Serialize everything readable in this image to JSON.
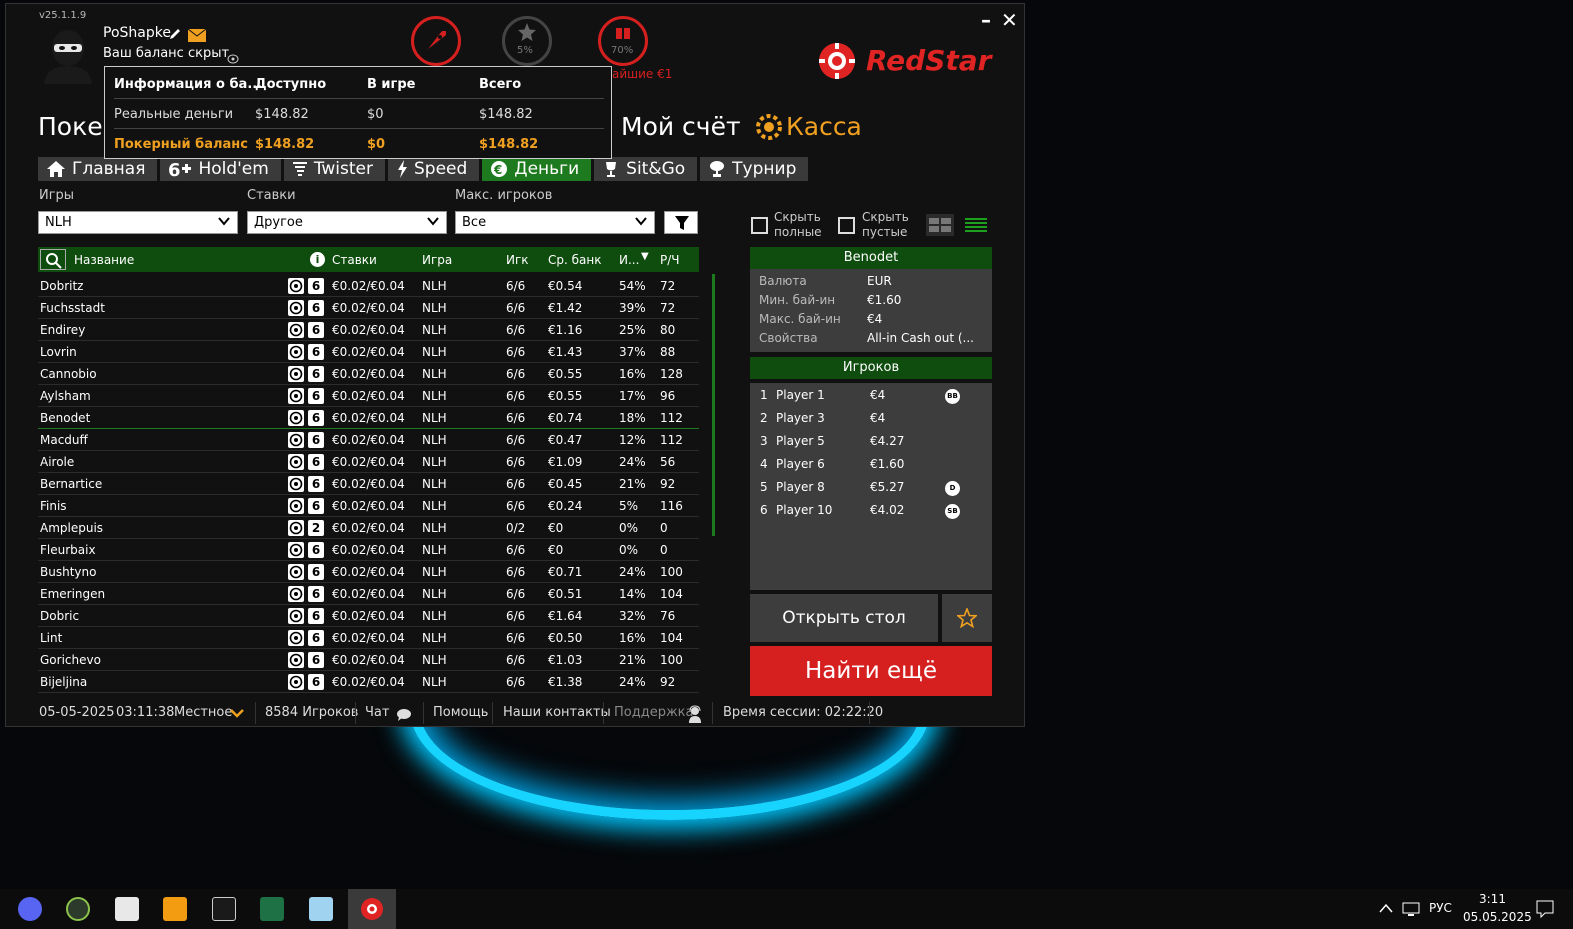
{
  "app": {
    "version": "v25.1.1.9",
    "brand": "RedStar",
    "brand_color": "#e02424",
    "accent_green": "#1e7a1e"
  },
  "user": {
    "name": "PoShapke",
    "balance_hidden": "Ваш баланс скрыт",
    "star_progress": "5%",
    "gift_progress": "70%",
    "gift_note": "айшие €1"
  },
  "balance_popup": {
    "headers": [
      "Информация о ба...",
      "Доступно",
      "В игре",
      "Всего"
    ],
    "rows": [
      [
        "Реальные деньги",
        "$148.82",
        "$0",
        "$148.82"
      ],
      [
        "Покерный баланс",
        "$148.82",
        "$0",
        "$148.82"
      ]
    ]
  },
  "header": {
    "poker_title": "Покер",
    "account": "Мой счёт",
    "cashier": "Касса"
  },
  "tabs": [
    {
      "label": "Главная",
      "icon": "home-icon"
    },
    {
      "label": "Hold'em",
      "icon": "sixplus-icon"
    },
    {
      "label": "Twister",
      "icon": "tornado-icon"
    },
    {
      "label": "Speed",
      "icon": "lightning-icon"
    },
    {
      "label": "Деньги",
      "icon": "euro-icon",
      "active": true
    },
    {
      "label": "Sit&Go",
      "icon": "trophy-icon"
    },
    {
      "label": "Турнир",
      "icon": "cup-icon"
    }
  ],
  "filters": {
    "games_label": "Игры",
    "games_value": "NLH",
    "stakes_label": "Ставки",
    "stakes_value": "Другое",
    "players_label": "Макс. игроков",
    "players_value": "Все",
    "hide_full_1": "Скрыть",
    "hide_full_2": "полные",
    "hide_empty_1": "Скрыть",
    "hide_empty_2": "пустые"
  },
  "table": {
    "headers": {
      "name": "Название",
      "stakes": "Ставки",
      "game": "Игра",
      "players": "Игк",
      "avg_pot": "Ср. банк",
      "flop": "И...",
      "hands": "Р/Ч"
    },
    "rows": [
      {
        "name": "Dobritz",
        "seats": "6",
        "stakes": "€0.02/€0.04",
        "game": "NLH",
        "players": "6/6",
        "avg_pot": "€0.54",
        "flop": "54%",
        "hands": "72"
      },
      {
        "name": "Fuchsstadt",
        "seats": "6",
        "stakes": "€0.02/€0.04",
        "game": "NLH",
        "players": "6/6",
        "avg_pot": "€1.42",
        "flop": "39%",
        "hands": "72"
      },
      {
        "name": "Endirey",
        "seats": "6",
        "stakes": "€0.02/€0.04",
        "game": "NLH",
        "players": "6/6",
        "avg_pot": "€1.16",
        "flop": "25%",
        "hands": "80"
      },
      {
        "name": "Lovrin",
        "seats": "6",
        "stakes": "€0.02/€0.04",
        "game": "NLH",
        "players": "6/6",
        "avg_pot": "€1.43",
        "flop": "37%",
        "hands": "88"
      },
      {
        "name": "Cannobio",
        "seats": "6",
        "stakes": "€0.02/€0.04",
        "game": "NLH",
        "players": "6/6",
        "avg_pot": "€0.55",
        "flop": "16%",
        "hands": "128"
      },
      {
        "name": "Aylsham",
        "seats": "6",
        "stakes": "€0.02/€0.04",
        "game": "NLH",
        "players": "6/6",
        "avg_pot": "€0.55",
        "flop": "17%",
        "hands": "96"
      },
      {
        "name": "Benodet",
        "seats": "6",
        "stakes": "€0.02/€0.04",
        "game": "NLH",
        "players": "6/6",
        "avg_pot": "€0.74",
        "flop": "18%",
        "hands": "112"
      },
      {
        "name": "Macduff",
        "seats": "6",
        "stakes": "€0.02/€0.04",
        "game": "NLH",
        "players": "6/6",
        "avg_pot": "€0.47",
        "flop": "12%",
        "hands": "112"
      },
      {
        "name": "Airole",
        "seats": "6",
        "stakes": "€0.02/€0.04",
        "game": "NLH",
        "players": "6/6",
        "avg_pot": "€1.09",
        "flop": "24%",
        "hands": "56"
      },
      {
        "name": "Bernartice",
        "seats": "6",
        "stakes": "€0.02/€0.04",
        "game": "NLH",
        "players": "6/6",
        "avg_pot": "€0.45",
        "flop": "21%",
        "hands": "92"
      },
      {
        "name": "Finis",
        "seats": "6",
        "stakes": "€0.02/€0.04",
        "game": "NLH",
        "players": "6/6",
        "avg_pot": "€0.24",
        "flop": "5%",
        "hands": "116"
      },
      {
        "name": "Amplepuis",
        "seats": "2",
        "stakes": "€0.02/€0.04",
        "game": "NLH",
        "players": "0/2",
        "avg_pot": "€0",
        "flop": "0%",
        "hands": "0"
      },
      {
        "name": "Fleurbaix",
        "seats": "6",
        "stakes": "€0.02/€0.04",
        "game": "NLH",
        "players": "6/6",
        "avg_pot": "€0",
        "flop": "0%",
        "hands": "0"
      },
      {
        "name": "Bushtyno",
        "seats": "6",
        "stakes": "€0.02/€0.04",
        "game": "NLH",
        "players": "6/6",
        "avg_pot": "€0.71",
        "flop": "24%",
        "hands": "100"
      },
      {
        "name": "Emeringen",
        "seats": "6",
        "stakes": "€0.02/€0.04",
        "game": "NLH",
        "players": "6/6",
        "avg_pot": "€0.51",
        "flop": "14%",
        "hands": "104"
      },
      {
        "name": "Dobric",
        "seats": "6",
        "stakes": "€0.02/€0.04",
        "game": "NLH",
        "players": "6/6",
        "avg_pot": "€1.64",
        "flop": "32%",
        "hands": "76"
      },
      {
        "name": "Lint",
        "seats": "6",
        "stakes": "€0.02/€0.04",
        "game": "NLH",
        "players": "6/6",
        "avg_pot": "€0.50",
        "flop": "16%",
        "hands": "104"
      },
      {
        "name": "Gorichevo",
        "seats": "6",
        "stakes": "€0.02/€0.04",
        "game": "NLH",
        "players": "6/6",
        "avg_pot": "€1.03",
        "flop": "21%",
        "hands": "100"
      },
      {
        "name": "Bijeljina",
        "seats": "6",
        "stakes": "€0.02/€0.04",
        "game": "NLH",
        "players": "6/6",
        "avg_pot": "€1.38",
        "flop": "24%",
        "hands": "92"
      }
    ]
  },
  "details": {
    "title": "Benodet",
    "rows": [
      [
        "Валюта",
        "EUR"
      ],
      [
        "Мин. бай-ин",
        "€1.60"
      ],
      [
        "Макс. бай-ин",
        "€4"
      ],
      [
        "Свойства",
        "All-in Cash out (..."
      ]
    ]
  },
  "players_panel": {
    "title": "Игроков",
    "rows": [
      {
        "num": "1",
        "name": "Player 1",
        "stack": "€4",
        "badge": "BB"
      },
      {
        "num": "2",
        "name": "Player 3",
        "stack": "€4",
        "badge": ""
      },
      {
        "num": "3",
        "name": "Player 5",
        "stack": "€4.27",
        "badge": ""
      },
      {
        "num": "4",
        "name": "Player 6",
        "stack": "€1.60",
        "badge": ""
      },
      {
        "num": "5",
        "name": "Player 8",
        "stack": "€5.27",
        "badge": "D"
      },
      {
        "num": "6",
        "name": "Player 10",
        "stack": "€4.02",
        "badge": "SB"
      }
    ]
  },
  "actions": {
    "open_table": "Открыть стол",
    "find_more": "Найти ещё"
  },
  "statusbar": {
    "date": "05-05-2025",
    "time": "03:11:38",
    "timezone": "Местное",
    "players_online": "8584 Игроков",
    "chat": "Чат",
    "help": "Помощь",
    "contacts": "Наши контакты",
    "support": "Поддержка",
    "session": "Время сессии: 02:22:20"
  },
  "taskbar": {
    "lang": "РУС",
    "time": "3:11",
    "date": "05.05.2025"
  }
}
